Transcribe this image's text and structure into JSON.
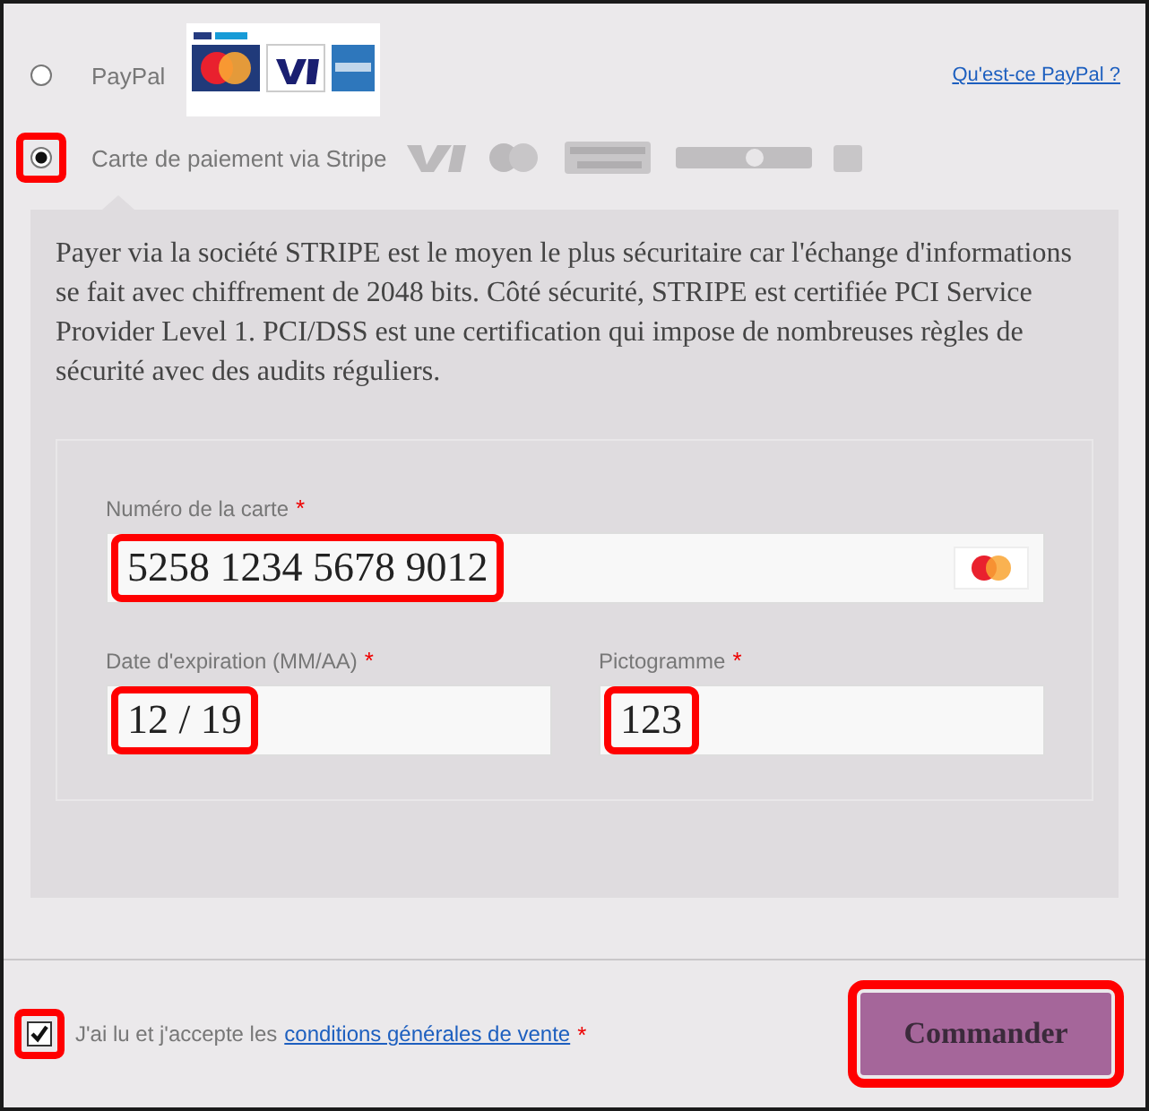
{
  "payment_methods": [
    {
      "label": "PayPal",
      "selected": false,
      "highlighted": false,
      "kind": "paypal"
    },
    {
      "label": "Carte de paiement via Stripe",
      "selected": true,
      "highlighted": true,
      "kind": "stripe"
    }
  ],
  "paypal_link": "Qu'est-ce PayPal ?",
  "stripe_panel": {
    "description": "Payer via la société STRIPE est le moyen le plus sécuritaire car l'échange d'informations se fait avec chiffrement de 2048 bits. Côté sécurité, STRIPE est certifiée PCI Service Provider Level 1. PCI/DSS est une certification qui impose de nombreuses règles de sécurité avec des audits réguliers.",
    "fields": [
      {
        "kind": "card",
        "label": "Numéro de la carte",
        "required_mark": "*",
        "value": "5258 1234 5678 9012",
        "highlighted": true
      },
      {
        "kind": "half",
        "label": "Date d'expiration (MM/AA)",
        "required_mark": "*",
        "value": "12 / 19",
        "highlighted": true
      },
      {
        "kind": "half",
        "label": "Pictogramme",
        "required_mark": "*",
        "value": "123",
        "highlighted": true
      }
    ]
  },
  "terms": {
    "checked": true,
    "highlighted": true,
    "text": "J'ai lu et j'accepte les",
    "link": "conditions générales de vente",
    "required_mark": "*"
  },
  "order_button": {
    "label": "Commander",
    "highlighted": true
  }
}
